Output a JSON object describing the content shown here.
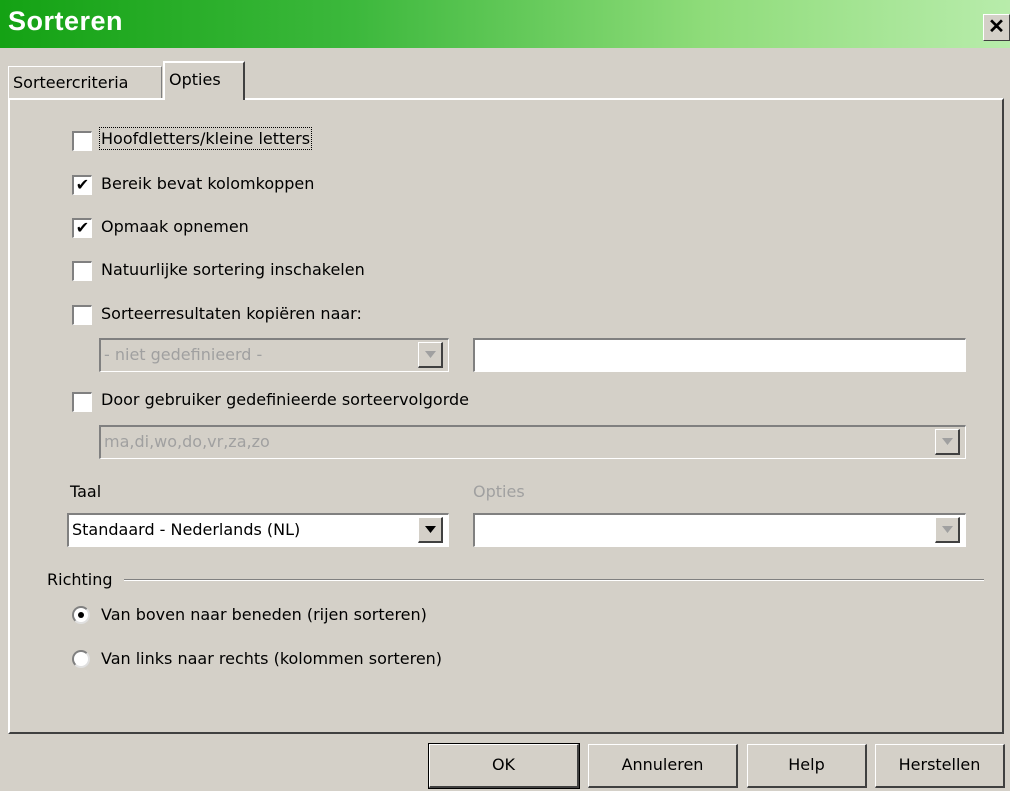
{
  "window": {
    "title": "Sorteren",
    "close_glyph": "✕"
  },
  "tabs": [
    {
      "label": "Sorteercriteria",
      "active": false
    },
    {
      "label": "Opties",
      "active": true
    }
  ],
  "options": {
    "case_sensitive": {
      "label": "Hoofdletters/kleine letters",
      "checked": false
    },
    "has_headers": {
      "label": "Bereik bevat kolomkoppen",
      "checked": true
    },
    "include_formats": {
      "label": "Opmaak opnemen",
      "checked": true
    },
    "natural_sort": {
      "label": "Natuurlijke sortering inschakelen",
      "checked": false
    },
    "copy_results": {
      "label": "Sorteerresultaten kopiëren naar:",
      "checked": false
    },
    "copy_target_select": "- niet gedefinieerd -",
    "copy_target_input": "",
    "custom_order": {
      "label": "Door gebruiker gedefinieerde sorteervolgorde",
      "checked": false
    },
    "custom_order_select": "ma,di,wo,do,vr,za,zo"
  },
  "language": {
    "label": "Taal",
    "value": "Standaard - Nederlands (NL)"
  },
  "algorithm": {
    "label": "Opties",
    "value": ""
  },
  "direction": {
    "label": "Richting",
    "items": [
      {
        "label": "Van boven naar beneden (rijen sorteren)",
        "selected": true
      },
      {
        "label": "Van links naar rechts (kolommen sorteren)",
        "selected": false
      }
    ]
  },
  "buttons": {
    "ok": "OK",
    "cancel": "Annuleren",
    "help": "Help",
    "reset": "Herstellen"
  },
  "icons": {
    "dropdown": "chevron-down-icon",
    "check": "✔"
  },
  "colors": {
    "title_gradient_start": "#14a214",
    "title_gradient_end": "#b8ecab",
    "face": "#d4d0c8"
  }
}
